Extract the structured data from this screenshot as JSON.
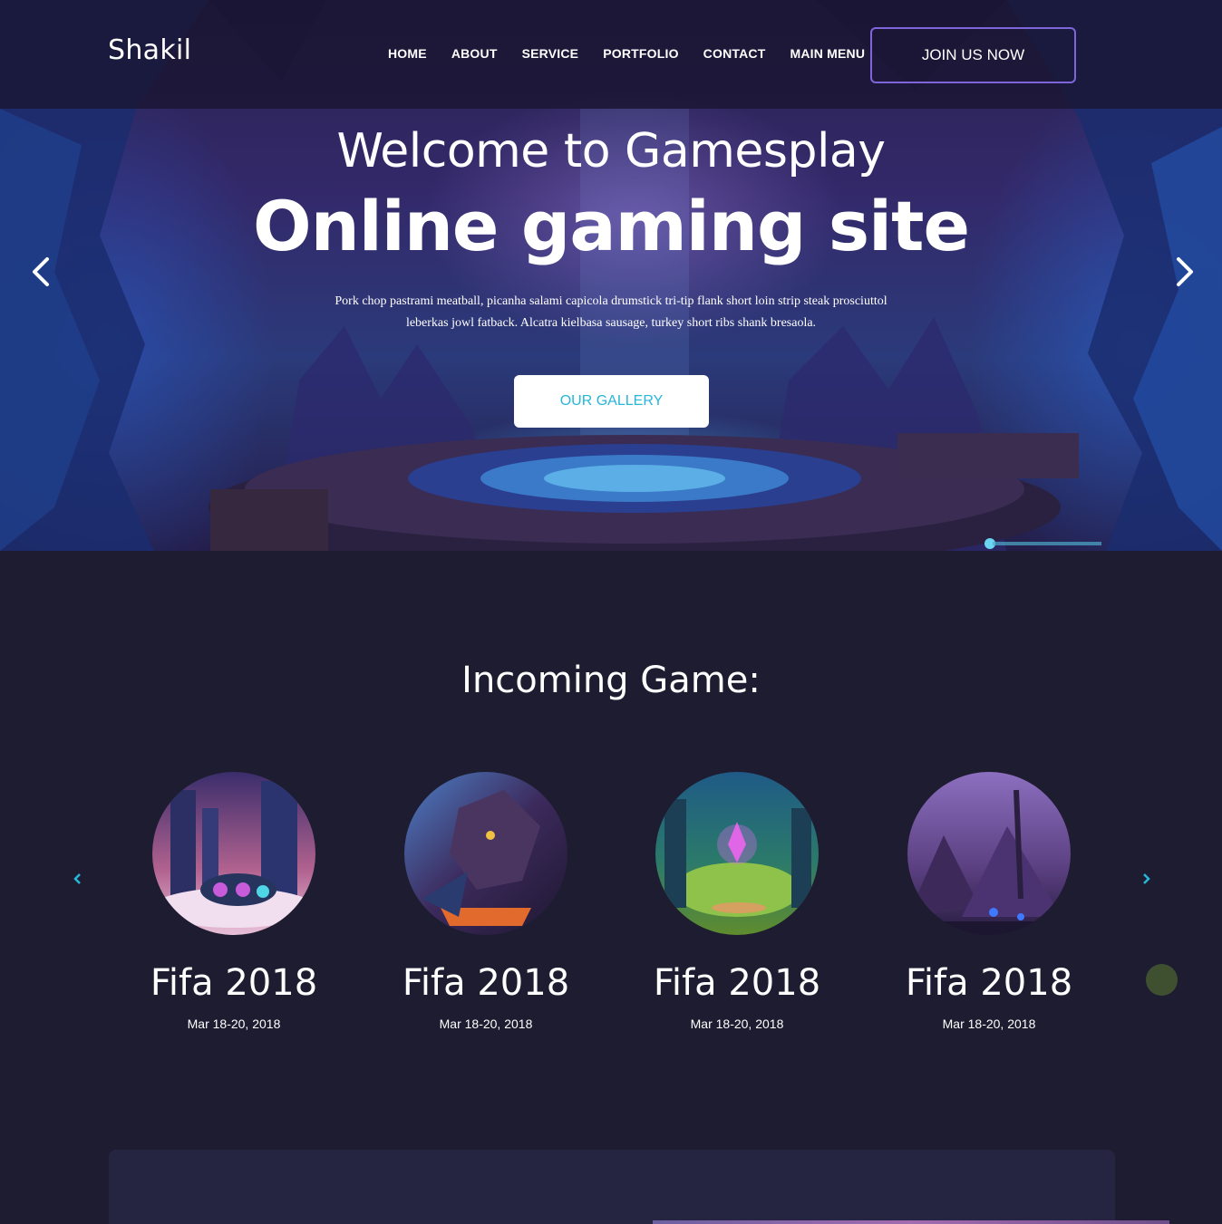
{
  "brand": {
    "logo": "Shakil"
  },
  "nav": {
    "items": [
      "HOME",
      "ABOUT",
      "SERVICE",
      "PORTFOLIO",
      "CONTACT",
      "MAIN MENU"
    ],
    "cta": "JOIN US NOW"
  },
  "hero": {
    "welcome": "Welcome to Gamesplay",
    "title": "Online gaming site",
    "description": "Pork chop pastrami meatball, picanha salami capicola drumstick tri-tip flank short loin strip steak prosciuttol leberkas jowl fatback. Alcatra kielbasa sausage, turkey short ribs shank bresaola.",
    "button": "OUR GALLERY",
    "prev_icon": "chevron-left-icon",
    "next_icon": "chevron-right-icon"
  },
  "incoming": {
    "title": "Incoming Game:",
    "games": [
      {
        "name": "Fifa 2018",
        "date": "Mar 18-20, 2018"
      },
      {
        "name": "Fifa 2018",
        "date": "Mar 18-20, 2018"
      },
      {
        "name": "Fifa 2018",
        "date": "Mar 18-20, 2018"
      },
      {
        "name": "Fifa 2018",
        "date": "Mar 18-20, 2018"
      }
    ]
  },
  "colors": {
    "background": "#1d1c30",
    "accent": "#27b7d9",
    "cta_border": "#7e65d9",
    "panel": "#262541"
  }
}
